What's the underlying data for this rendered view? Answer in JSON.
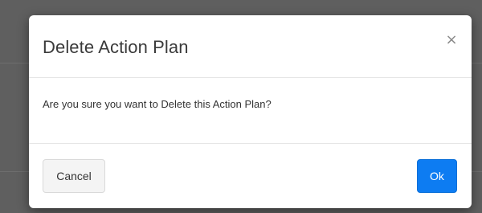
{
  "dialog": {
    "title": "Delete Action Plan",
    "close_glyph": "×",
    "message": "Are you sure you want to Delete this Action Plan?",
    "cancel_label": "Cancel",
    "ok_label": "Ok"
  },
  "colors": {
    "backdrop": "#5f5f5f",
    "primary": "#0d7cf2",
    "secondary_bg": "#f4f4f4"
  },
  "icons": {
    "close": "close-icon"
  }
}
